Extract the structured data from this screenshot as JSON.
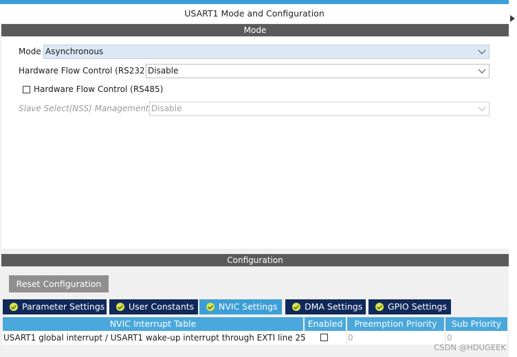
{
  "window": {
    "title": "USART1 Mode and Configuration"
  },
  "mode_section": {
    "header": "Mode",
    "mode": {
      "label": "Mode",
      "value": "Asynchronous"
    },
    "flow_rs232": {
      "label": "Hardware Flow Control (RS232)",
      "value": "Disable"
    },
    "flow_rs485": {
      "label": "Hardware Flow Control (RS485)",
      "checked": false
    },
    "nss": {
      "label": "Slave Select(NSS) Management",
      "value": "Disable",
      "enabled": false
    }
  },
  "config_section": {
    "header": "Configuration",
    "reset_label": "Reset Configuration",
    "tabs": [
      {
        "label": "Parameter Settings",
        "active": false
      },
      {
        "label": "User Constants",
        "active": false
      },
      {
        "label": "NVIC Settings",
        "active": true
      },
      {
        "label": "DMA Settings",
        "active": false
      },
      {
        "label": "GPIO Settings",
        "active": false
      }
    ],
    "table": {
      "columns": [
        "NVIC Interrupt Table",
        "Enabled",
        "Preemption Priority",
        "Sub Priority"
      ],
      "rows": [
        {
          "name": "USART1 global interrupt / USART1 wake-up interrupt through EXTI line 25",
          "enabled": false,
          "preemption": "0",
          "sub": "0"
        }
      ]
    }
  },
  "watermark": "CSDN @HDUGEEK",
  "colors": {
    "accent": "#3d9fd8",
    "tab_inactive": "#11295a",
    "tab_active": "#3c9ed6",
    "header_bg": "#5a5a5a"
  }
}
